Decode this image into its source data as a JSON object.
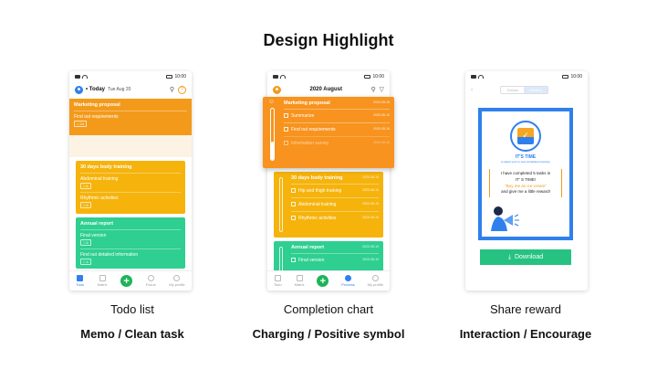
{
  "heading": "Design Highlight",
  "status_time": "10:00",
  "colors": {
    "orange": "#f39a1b",
    "amber": "#f5b30c",
    "green": "#2ecf90",
    "blue": "#2f80ed",
    "cta": "#26c281"
  },
  "phone1": {
    "today_label": "• Today",
    "date": "Tue  Aug 20",
    "card1": {
      "title": "Marketing proposal",
      "item": "Find out requirements",
      "badge": "□ 24"
    },
    "card2": {
      "title": "30 days body training",
      "items": [
        {
          "label": "Abdominal training",
          "badge": "□ 6"
        },
        {
          "label": "Rhythmic activities",
          "badge": "□ 6"
        }
      ]
    },
    "card3": {
      "title": "Annual report",
      "items": [
        {
          "label": "Final version",
          "badge": "□ 6"
        },
        {
          "label": "Find out detailed information",
          "badge": "□ 4"
        }
      ]
    },
    "tabs": [
      "Todo",
      "Matrix",
      "",
      "Focus",
      "My profile"
    ]
  },
  "phone2": {
    "header": "2020 August",
    "card1": {
      "title": "Marketing proposal",
      "date": "2020-08-19",
      "items": [
        {
          "label": "Summarize",
          "date": "2020-08-19"
        },
        {
          "label": "Find out requirements",
          "date": "2020-08-19"
        },
        {
          "label": "Information survey",
          "date": "2020-08-19"
        }
      ]
    },
    "card2": {
      "title": "30 days body training",
      "date": "2020-08-19",
      "items": [
        {
          "label": "Hip and thigh training",
          "date": "2020-08-19"
        },
        {
          "label": "Abdominal training",
          "date": "2020-08-19"
        },
        {
          "label": "Rhythmic activities",
          "date": "2020-08-19"
        }
      ]
    },
    "card3": {
      "title": "Annual report",
      "date": "2020-08-19",
      "items": [
        {
          "label": "Final version",
          "date": "2020-08-19"
        }
      ]
    },
    "tabs": [
      "Todo",
      "Matrix",
      "",
      "Process",
      "My profile"
    ]
  },
  "phone3": {
    "toggle_left": "Classic",
    "toggle_right": "Modern",
    "reward_title": "IT'S TIME",
    "reward_sub": "to adopt your to-new workplace leisurely.",
    "msg1": "I have completed 5 tasks in",
    "msg2": "IT' S TIME!",
    "msg3": "\"Buy me an ice-cream\"",
    "msg4": "and give me a little reward!",
    "download_label": "Download"
  },
  "captions": [
    {
      "name": "Todo list",
      "sub": "Memo / Clean task"
    },
    {
      "name": "Completion chart",
      "sub": "Charging / Positive symbol"
    },
    {
      "name": "Share reward",
      "sub": "Interaction / Encourage"
    }
  ]
}
